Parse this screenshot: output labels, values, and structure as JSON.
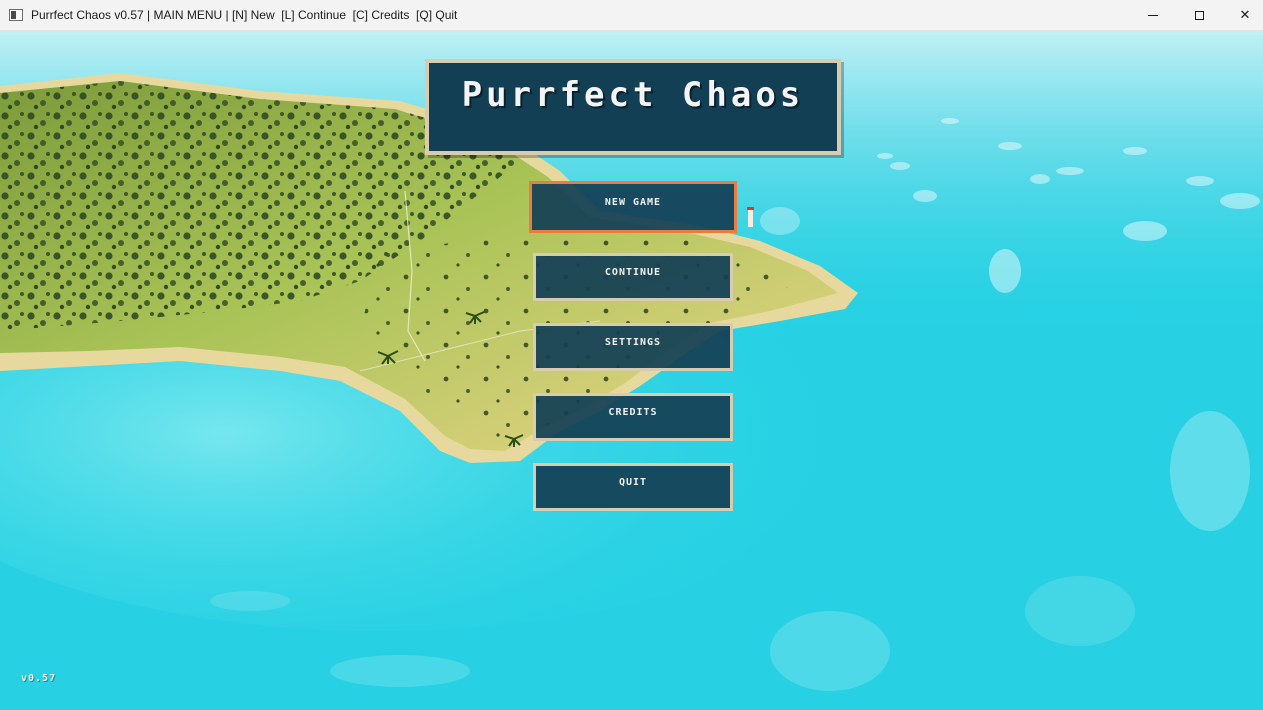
{
  "window": {
    "title": "Purrfect Chaos v0.57 | MAIN MENU | [N] New  [L] Continue  [C] Credits  [Q] Quit",
    "controls": {
      "minimize_icon": "minimize-icon",
      "maximize_icon": "maximize-icon",
      "close_icon": "close-icon",
      "close_glyph": "✕"
    }
  },
  "game": {
    "title": "Purrfect Chaos",
    "menu": {
      "selected": "new_game",
      "items": [
        {
          "id": "new_game",
          "label": "NEW GAME"
        },
        {
          "id": "continue",
          "label": "CONTINUE"
        },
        {
          "id": "settings",
          "label": "SETTINGS"
        },
        {
          "id": "credits",
          "label": "CREDITS"
        },
        {
          "id": "quit",
          "label": "QUIT"
        }
      ]
    },
    "version": "v0.57"
  },
  "colors": {
    "panel": "#133f55",
    "panel_border": "#d8ccb0",
    "selected_border": "#ea7d3e",
    "ocean": "#1fd0e0",
    "grass": "#9fbf4a",
    "sand": "#e9d79a"
  }
}
